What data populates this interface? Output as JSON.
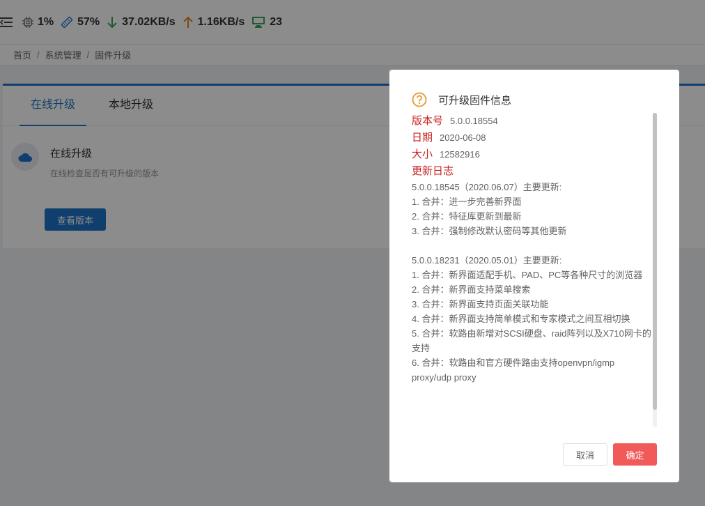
{
  "topbar": {
    "cpu": "1%",
    "memory": "57%",
    "download": "37.02KB/s",
    "upload": "1.16KB/s",
    "devices": "23"
  },
  "breadcrumb": [
    "首页",
    "系统管理",
    "固件升级"
  ],
  "tabs": [
    "在线升级",
    "本地升级"
  ],
  "online": {
    "title": "在线升级",
    "desc": "在线检查是否有可升级的版本",
    "button": "查看版本"
  },
  "dialog": {
    "title": "可升级固件信息",
    "version_label": "版本号",
    "version": "5.0.0.18554",
    "date_label": "日期",
    "date": "2020-06-08",
    "size_label": "大小",
    "size": "12582916",
    "log_label": "更新日志",
    "log": [
      "5.0.0.18545（2020.06.07）主要更新:",
      "1. 合并：进一步完善新界面",
      "2. 合并：特征库更新到最新",
      "3. 合并：强制修改默认密码等其他更新",
      "",
      "5.0.0.18231（2020.05.01）主要更新:",
      "1. 合并：新界面适配手机、PAD、PC等各种尺寸的浏览器",
      "2. 合并：新界面支持菜单搜索",
      "3. 合并：新界面支持页面关联功能",
      "4. 合并：新界面支持简单模式和专家模式之间互相切换",
      "5. 合并：软路由新增对SCSI硬盘、raid阵列以及X710网卡的支持",
      "6. 合并：软路由和官方硬件路由支持openvpn/igmp proxy/udp proxy"
    ],
    "cancel": "取消",
    "ok": "确定"
  },
  "colors": {
    "primary": "#1e73c8",
    "danger": "#f25a5a",
    "label_red": "#c81f1f",
    "warning_icon": "#e6a23c"
  }
}
